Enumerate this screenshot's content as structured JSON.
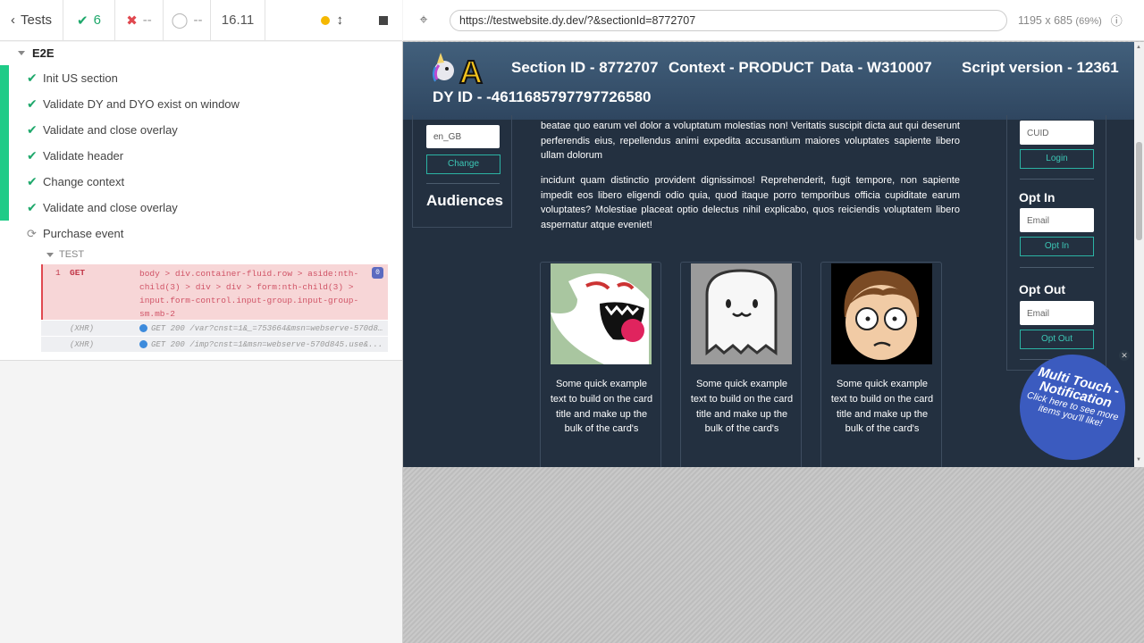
{
  "runner": {
    "back_label": "Tests",
    "passed_count": "6",
    "failed_count": "--",
    "pending_count": "--",
    "duration": "16.11",
    "suite_name": "E2E",
    "tests": [
      {
        "title": "Init US section",
        "state": "passed"
      },
      {
        "title": "Validate DY and DYO exist on window",
        "state": "passed"
      },
      {
        "title": "Validate and close overlay",
        "state": "passed"
      },
      {
        "title": "Validate header",
        "state": "passed"
      },
      {
        "title": "Change context",
        "state": "passed"
      },
      {
        "title": "Validate and close overlay",
        "state": "passed"
      },
      {
        "title": "Purchase event",
        "state": "running"
      }
    ],
    "section_label": "TEST",
    "command": {
      "number": "1",
      "name": "GET",
      "message": "body > div.container-fluid.row > aside:nth-child(3) > div > div > form:nth-child(3) > input.form-control.input-group.input-group-sm.mb-2",
      "badge": "0"
    },
    "xhr_rows": [
      {
        "label": "(XHR)",
        "text": "GET 200 /var?cnst=1&_=753664&msn=webserve-570d845.use&..."
      },
      {
        "label": "(XHR)",
        "text": "GET 200 /imp?cnst=1&msn=webserve-570d845.use&..."
      }
    ]
  },
  "browser": {
    "url": "https://testwebsite.dy.dev/?&sectionId=8772707",
    "viewport_size": "1195 x 685",
    "zoom": "(69%)"
  },
  "app": {
    "section_id": "Section ID - 8772707",
    "context": "Context - PRODUCT",
    "data": "Data - W310007",
    "script_version": "Script version - 12361",
    "dy_id": "DY ID - -4611685797797726580",
    "left": {
      "locale_value": "en_GB",
      "change_label": "Change",
      "audiences_title": "Audiences"
    },
    "paragraph1": "beatae quo earum vel dolor a voluptatum molestias non! Veritatis suscipit dicta aut qui deserunt perferendis eius, repellendus animi expedita accusantium maiores voluptates sapiente libero ullam dolorum",
    "paragraph2": "incidunt quam distinctio provident dignissimos! Reprehenderit, fugit tempore, non sapiente impedit eos libero eligendi odio quia, quod itaque porro temporibus officia cupiditate earum voluptates? Molestiae placeat optio delectus nihil explicabo, quos reiciendis voluptatem libero aspernatur atque eveniet!",
    "cards": [
      {
        "text": "Some quick example text to build on the card title and make up the bulk of the card's",
        "image": "boo-ghost"
      },
      {
        "text": "Some quick example text to build on the card title and make up the bulk of the card's",
        "image": "white-ghost"
      },
      {
        "text": "Some quick example text to build on the card title and make up the bulk of the card's",
        "image": "cartoon-boy"
      }
    ],
    "right": {
      "cuid_placeholder": "CUID",
      "login_label": "Login",
      "optin_title": "Opt In",
      "optin_placeholder": "Email",
      "optin_button": "Opt In",
      "optout_title": "Opt Out",
      "optout_placeholder": "Email",
      "optout_button": "Opt Out"
    },
    "notification": {
      "title": "Multi Touch - Notification",
      "subtitle": "Click here to see more items you'll like!"
    }
  },
  "colors": {
    "pass": "#1ea86b",
    "fail_bg": "#f7d6d7",
    "app_bg": "#233040",
    "accent_teal": "#2bb3a4",
    "notification": "#3b5bbf"
  }
}
